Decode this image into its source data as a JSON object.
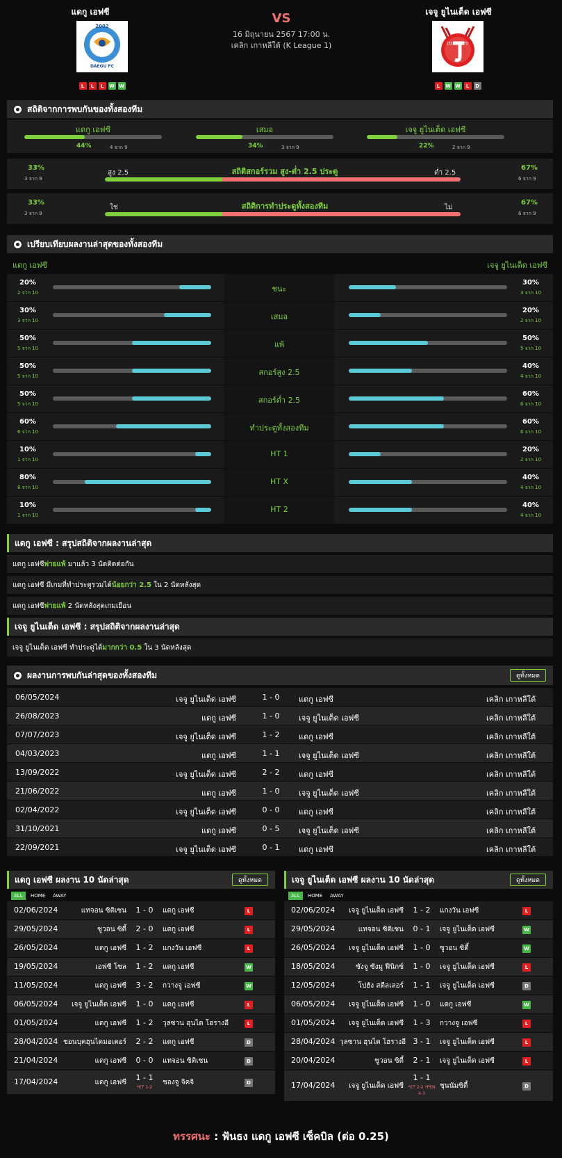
{
  "match": {
    "home": "แดกู เอฟซี",
    "away": "เจจู ยูไนเต็ด เอฟซี",
    "vs": "VS",
    "datetime": "16 มิถุนายน 2567 17:00 น.",
    "league": "เคลิก เกาหลีใต้ (K League 1)",
    "home_form": [
      "L",
      "L",
      "L",
      "W",
      "W"
    ],
    "away_form": [
      "L",
      "W",
      "W",
      "L",
      "D"
    ],
    "home_logo_year": "2002",
    "home_logo_text": "DAEGU FC",
    "away_logo_text": "JEJU UNITED"
  },
  "h2h_stats": {
    "title": "สถิติจากการพบกันของทั้งสองทีม",
    "home": {
      "label": "แดกู เอฟซี",
      "pct": "44%",
      "count": "4 จาก 9",
      "value": 0.44
    },
    "draw": {
      "label": "เสมอ",
      "pct": "34%",
      "count": "3 จาก 9",
      "value": 0.34
    },
    "away": {
      "label": "เจจู ยูไนเต็ด เอฟซี",
      "pct": "22%",
      "count": "2 จาก 9",
      "value": 0.22
    },
    "ou": {
      "title": "สถิติสกอร์รวม สูง-ต่ำ 2.5 ประตู",
      "left_label": "สูง 2.5",
      "right_label": "ต่ำ 2.5",
      "left_pct": "33%",
      "left_count": "3 จาก 9",
      "right_pct": "67%",
      "right_count": "6 จาก 9",
      "value": 0.33
    },
    "btts": {
      "title": "สถิติการทำประตูทั้งสองทีม",
      "left_label": "ใช่",
      "right_label": "ไม่",
      "left_pct": "33%",
      "left_count": "3 จาก 9",
      "right_pct": "67%",
      "right_count": "6 จาก 9",
      "value": 0.33
    }
  },
  "compare": {
    "title": "เปรียบเทียบผลงานล่าสุดของทั้งสองทีม",
    "home": "แดกู เอฟซี",
    "away": "เจจู ยูไนเต็ด เอฟซี",
    "rows": [
      {
        "label": "ชนะ",
        "lp": "20%",
        "lc": "2 จาก 10",
        "lv": 0.2,
        "rp": "30%",
        "rc": "3 จาก 10",
        "rv": 0.3
      },
      {
        "label": "เสมอ",
        "lp": "30%",
        "lc": "3 จาก 10",
        "lv": 0.3,
        "rp": "20%",
        "rc": "2 จาก 10",
        "rv": 0.2
      },
      {
        "label": "แพ้",
        "lp": "50%",
        "lc": "5 จาก 10",
        "lv": 0.5,
        "rp": "50%",
        "rc": "5 จาก 10",
        "rv": 0.5
      },
      {
        "label": "สกอร์สูง 2.5",
        "lp": "50%",
        "lc": "5 จาก 10",
        "lv": 0.5,
        "rp": "40%",
        "rc": "4 จาก 10",
        "rv": 0.4
      },
      {
        "label": "สกอร์ต่ำ 2.5",
        "lp": "50%",
        "lc": "5 จาก 10",
        "lv": 0.5,
        "rp": "60%",
        "rc": "6 จาก 10",
        "rv": 0.6
      },
      {
        "label": "ทำประตูทั้งสองทีม",
        "lp": "60%",
        "lc": "6 จาก 10",
        "lv": 0.6,
        "rp": "60%",
        "rc": "6 จาก 10",
        "rv": 0.6
      },
      {
        "label": "HT 1",
        "lp": "10%",
        "lc": "1 จาก 10",
        "lv": 0.1,
        "rp": "20%",
        "rc": "2 จาก 10",
        "rv": 0.2
      },
      {
        "label": "HT X",
        "lp": "80%",
        "lc": "8 จาก 10",
        "lv": 0.8,
        "rp": "40%",
        "rc": "4 จาก 10",
        "rv": 0.4
      },
      {
        "label": "HT 2",
        "lp": "10%",
        "lc": "1 จาก 10",
        "lv": 0.1,
        "rp": "40%",
        "rc": "4 จาก 10",
        "rv": 0.4
      }
    ]
  },
  "summary_home": {
    "title": "แดกู เอฟซี : สรุปสถิติจากผลงานล่าสุด",
    "lines": [
      {
        "a": "แดกู เอฟซี ",
        "b": "พ่ายแพ้",
        "c": " มาแล้ว 3 นัดติดต่อกัน"
      },
      {
        "a": "แดกู เอฟซี มีเกมที่ทำประตูรวมได้ ",
        "b": "น้อยกว่า 2.5",
        "c": " ใน 2 นัดหลังสุด"
      },
      {
        "a": "แดกู เอฟซี ",
        "b": "พ่ายแพ้",
        "c": " 2 นัดหลังสุดเกมเยือน"
      }
    ]
  },
  "summary_away": {
    "title": "เจจู ยูไนเต็ด เอฟซี : สรุปสถิติจากผลงานล่าสุด",
    "lines": [
      {
        "a": "เจจู ยูไนเต็ด เอฟซี ทำประตูได้ ",
        "b": "มากกว่า 0.5",
        "c": " ใน 3 นัดหลังสุด"
      }
    ]
  },
  "h2h_results": {
    "title": "ผลงานการพบกันล่าสุดของทั้งสองทีม",
    "view_all": "ดูทั้งหมด",
    "rows": [
      {
        "date": "06/05/2024",
        "home": "เจจู ยูไนเต็ด เอฟซี",
        "score": "1 - 0",
        "away": "แดกู เอฟซี",
        "league": "เคลิก เกาหลีใต้"
      },
      {
        "date": "26/08/2023",
        "home": "แดกู เอฟซี",
        "score": "1 - 0",
        "away": "เจจู ยูไนเต็ด เอฟซี",
        "league": "เคลิก เกาหลีใต้"
      },
      {
        "date": "07/07/2023",
        "home": "เจจู ยูไนเต็ด เอฟซี",
        "score": "1 - 2",
        "away": "แดกู เอฟซี",
        "league": "เคลิก เกาหลีใต้"
      },
      {
        "date": "04/03/2023",
        "home": "แดกู เอฟซี",
        "score": "1 - 1",
        "away": "เจจู ยูไนเต็ด เอฟซี",
        "league": "เคลิก เกาหลีใต้"
      },
      {
        "date": "13/09/2022",
        "home": "เจจู ยูไนเต็ด เอฟซี",
        "score": "2 - 2",
        "away": "แดกู เอฟซี",
        "league": "เคลิก เกาหลีใต้"
      },
      {
        "date": "21/06/2022",
        "home": "แดกู เอฟซี",
        "score": "1 - 0",
        "away": "เจจู ยูไนเต็ด เอฟซี",
        "league": "เคลิก เกาหลีใต้"
      },
      {
        "date": "02/04/2022",
        "home": "เจจู ยูไนเต็ด เอฟซี",
        "score": "0 - 0",
        "away": "แดกู เอฟซี",
        "league": "เคลิก เกาหลีใต้"
      },
      {
        "date": "31/10/2021",
        "home": "แดกู เอฟซี",
        "score": "0 - 5",
        "away": "เจจู ยูไนเต็ด เอฟซี",
        "league": "เคลิก เกาหลีใต้"
      },
      {
        "date": "22/09/2021",
        "home": "เจจู ยูไนเต็ด เอฟซี",
        "score": "0 - 1",
        "away": "แดกู เอฟซี",
        "league": "เคลิก เกาหลีใต้"
      }
    ]
  },
  "last10_home": {
    "title": "แดกู เอฟซี ผลงาน 10 นัดล่าสุด",
    "view_all": "ดูทั้งหมด",
    "tabs": [
      "ALL",
      "HOME",
      "AWAY"
    ],
    "rows": [
      {
        "date": "02/06/2024",
        "home": "แทจอน ซิติเซน",
        "score": "1 - 0",
        "away": "แดกู เอฟซี",
        "res": "L"
      },
      {
        "date": "29/05/2024",
        "home": "ซูวอน ซิตี้",
        "score": "2 - 0",
        "away": "แดกู เอฟซี",
        "res": "L"
      },
      {
        "date": "26/05/2024",
        "home": "แดกู เอฟซี",
        "score": "1 - 2",
        "away": "แกงวัน เอฟซี",
        "res": "L"
      },
      {
        "date": "19/05/2024",
        "home": "เอฟซี โซล",
        "score": "1 - 2",
        "away": "แดกู เอฟซี",
        "res": "W"
      },
      {
        "date": "11/05/2024",
        "home": "แดกู เอฟซี",
        "score": "3 - 2",
        "away": "กวางจู เอฟซี",
        "res": "W"
      },
      {
        "date": "06/05/2024",
        "home": "เจจู ยูไนเต็ด เอฟซี",
        "score": "1 - 0",
        "away": "แดกู เอฟซี",
        "res": "L"
      },
      {
        "date": "01/05/2024",
        "home": "แดกู เอฟซี",
        "score": "1 - 2",
        "away": "วุลซาน ฮุนได โฮรางอี",
        "res": "L"
      },
      {
        "date": "28/04/2024",
        "home": "ชอนบุคฮุนไดมอเตอร์",
        "score": "2 - 2",
        "away": "แดกู เอฟซี",
        "res": "D"
      },
      {
        "date": "21/04/2024",
        "home": "แดกู เอฟซี",
        "score": "0 - 0",
        "away": "แทจอน ซิติเซน",
        "res": "D"
      },
      {
        "date": "17/04/2024",
        "home": "แดกู เอฟซี",
        "score": "1 - 1",
        "note": "*ET 1-2",
        "away": "ชองจู จิคจิ",
        "res": "D"
      }
    ]
  },
  "last10_away": {
    "title": "เจจู ยูไนเต็ด เอฟซี ผลงาน 10 นัดล่าสุด",
    "view_all": "ดูทั้งหมด",
    "tabs": [
      "ALL",
      "HOME",
      "AWAY"
    ],
    "rows": [
      {
        "date": "02/06/2024",
        "home": "เจจู ยูไนเต็ด เอฟซี",
        "score": "1 - 2",
        "away": "แกงวัน เอฟซี",
        "res": "L"
      },
      {
        "date": "29/05/2024",
        "home": "แทจอน ซิติเซน",
        "score": "0 - 1",
        "away": "เจจู ยูไนเต็ด เอฟซี",
        "res": "W"
      },
      {
        "date": "26/05/2024",
        "home": "เจจู ยูไนเต็ด เอฟซี",
        "score": "1 - 0",
        "away": "ซูวอน ซิตี้",
        "res": "W"
      },
      {
        "date": "18/05/2024",
        "home": "ซังจู ซังมู ฟีนิกซ์",
        "score": "1 - 0",
        "away": "เจจู ยูไนเต็ด เอฟซี",
        "res": "L"
      },
      {
        "date": "12/05/2024",
        "home": "โปฮัง สตีลเลอร์",
        "score": "1 - 1",
        "away": "เจจู ยูไนเต็ด เอฟซี",
        "res": "D"
      },
      {
        "date": "06/05/2024",
        "home": "เจจู ยูไนเต็ด เอฟซี",
        "score": "1 - 0",
        "away": "แดกู เอฟซี",
        "res": "W"
      },
      {
        "date": "01/05/2024",
        "home": "เจจู ยูไนเต็ด เอฟซี",
        "score": "1 - 3",
        "away": "กวางจู เอฟซี",
        "res": "L"
      },
      {
        "date": "28/04/2024",
        "home": "วุลซาน ฮุนได โฮรางอี",
        "score": "3 - 1",
        "away": "เจจู ยูไนเต็ด เอฟซี",
        "res": "L"
      },
      {
        "date": "20/04/2024",
        "home": "ซูวอน ซิตี้",
        "score": "2 - 1",
        "away": "เจจู ยูไนเต็ด เอฟซี",
        "res": "L"
      },
      {
        "date": "17/04/2024",
        "home": "เจจู ยูไนเต็ด เอฟซี",
        "score": "1 - 1",
        "note": "*ET 2-2 *PEN 4-3",
        "away": "ชุนนัมซิตี้",
        "res": "D"
      }
    ]
  },
  "verdict": {
    "label": "ทรรศนะ",
    "colon": " : ",
    "text": "ฟันธง แดกู เอฟซี เซ็คบิล (ต่อ 0.25)"
  },
  "colors": {
    "accent": "#7ed03c",
    "bar": "#5cc9d6",
    "red": "#f07070",
    "loss": "#e02020",
    "win": "#47b847"
  }
}
